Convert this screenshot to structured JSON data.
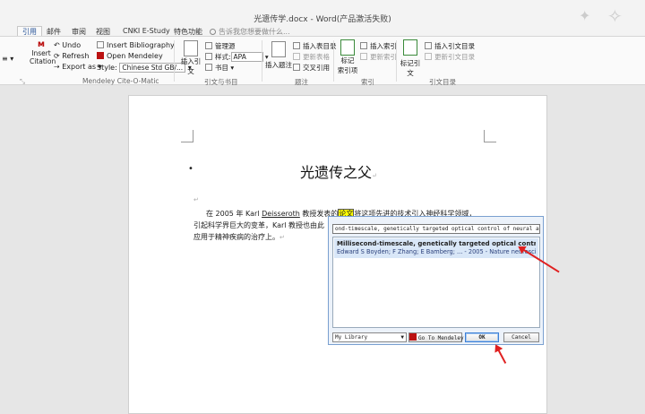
{
  "window": {
    "title": "光遗传学.docx - Word(产品激活失败)"
  },
  "tabs": [
    "引用",
    "邮件",
    "审阅",
    "视图",
    "CNKI E-Study",
    "特色功能"
  ],
  "tell_me": {
    "placeholder": "告诉我您想要做什么..."
  },
  "ribbon": {
    "mendeley": {
      "insert_citation": [
        "Insert",
        "Citation"
      ],
      "undo": "Undo",
      "refresh": "Refresh",
      "export_as": "Export as",
      "insert_bibliography": "Insert Bibliography",
      "open_mendeley": "Open Mendeley",
      "style_label": "Style:",
      "style_value": "Chinese Std GB/...",
      "group_label": "Mendeley Cite-O-Matic"
    },
    "citations": {
      "insert_citation": "插入引文",
      "manage_sources": "管理源",
      "style_label": "样式:",
      "style_value": "APA",
      "bibliography": "书目",
      "group_label": "引文与书目"
    },
    "captions": {
      "insert_caption": "插入题注",
      "insert_table_of_figures": "插入表目录",
      "update_table": "更新表格",
      "cross_reference": "交叉引用",
      "group_label": "题注"
    },
    "index": {
      "mark_entry": [
        "标记",
        "索引项"
      ],
      "insert_index": "插入索引",
      "update_index": "更新索引",
      "group_label": "索引"
    },
    "toa": {
      "mark_citation": "标记引文",
      "insert_toa": "插入引文目录",
      "update_toa": "更新引文目录",
      "group_label": "引文目录"
    }
  },
  "document": {
    "heading": "光遗传之父",
    "paragraph": {
      "line1_pre": "在 2005 年 Karl ",
      "line1_name": "Deisseroth",
      "line1_mid": " 教授发表的",
      "line1_hl": "论文",
      "line1_post": "将这项先进的技术引入神经科学领域，",
      "line2": "引起科学界巨大的变革，Karl 教授也由此",
      "line3": "应用于精神疾病的治疗上。"
    }
  },
  "citation_dialog": {
    "search_value": "ond-timescale, genetically targeted optical control of neural activity",
    "result": {
      "title": "Millisecond-timescale, genetically targeted optical control of neural",
      "meta": "Edward S Boyden; F Zhang; E Bamberg; ... - 2005 - Nature neuroscience"
    },
    "library": "My Library",
    "go_to_mendeley": "Go To Mendeley",
    "ok": "OK",
    "cancel": "Cancel"
  }
}
